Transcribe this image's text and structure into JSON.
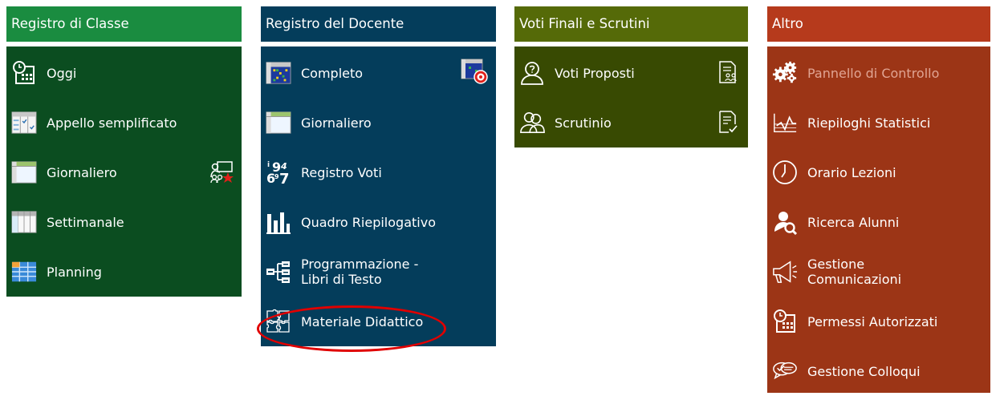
{
  "registro_classe": {
    "title": "Registro di Classe",
    "items": [
      {
        "label": "Oggi",
        "icon": "calendar-clock-icon"
      },
      {
        "label": "Appello semplificato",
        "icon": "roll-call-icon"
      },
      {
        "label": "Giornaliero",
        "icon": "daily-register-icon",
        "right_icon": "teacher-board-star-icon"
      },
      {
        "label": "Settimanale",
        "icon": "weekly-register-icon"
      },
      {
        "label": "Planning",
        "icon": "planning-grid-icon"
      }
    ]
  },
  "registro_docente": {
    "title": "Registro del Docente",
    "items": [
      {
        "label": "Completo",
        "icon": "grid-register-icon",
        "right_icon": "grid-target-icon"
      },
      {
        "label": "Giornaliero",
        "icon": "daily-register-icon"
      },
      {
        "label": "Registro Voti",
        "icon": "grades-numbers-icon"
      },
      {
        "label": "Quadro Riepilogativo",
        "icon": "bar-chart-icon"
      },
      {
        "label_line1": "Programmazione -",
        "label_line2": "Libri di Testo",
        "icon": "tree-structure-icon"
      },
      {
        "label": "Materiale Didattico",
        "icon": "puzzle-icon"
      }
    ]
  },
  "voti_finali": {
    "title": "Voti Finali e Scrutini",
    "items": [
      {
        "label": "Voti Proposti",
        "icon": "user-question-icon",
        "right_icon": "document-users-icon"
      },
      {
        "label": "Scrutinio",
        "icon": "users-group-icon",
        "right_icon": "document-check-icon"
      }
    ]
  },
  "altro": {
    "title": "Altro",
    "items": [
      {
        "label": "Pannello di Controllo",
        "icon": "gears-icon",
        "disabled": true
      },
      {
        "label": "Riepiloghi Statistici",
        "icon": "statistics-chart-icon"
      },
      {
        "label": "Orario Lezioni",
        "icon": "clock-icon"
      },
      {
        "label": "Ricerca Alunni",
        "icon": "user-search-icon"
      },
      {
        "label_line1": "Gestione",
        "label_line2": "Comunicazioni",
        "icon": "megaphone-icon"
      },
      {
        "label": "Permessi Autorizzati",
        "icon": "calendar-clock-icon"
      },
      {
        "label": "Gestione Colloqui",
        "icon": "chat-bubbles-icon"
      }
    ]
  },
  "colors": {
    "classe_header": "#1a8c40",
    "classe_body": "#0b4d20",
    "docente": "#043d5b",
    "voti_header": "#556a08",
    "voti_body": "#384a02",
    "altro_header": "#b63a1c",
    "altro_body": "#9c3516",
    "highlight_ring": "#e00000"
  }
}
